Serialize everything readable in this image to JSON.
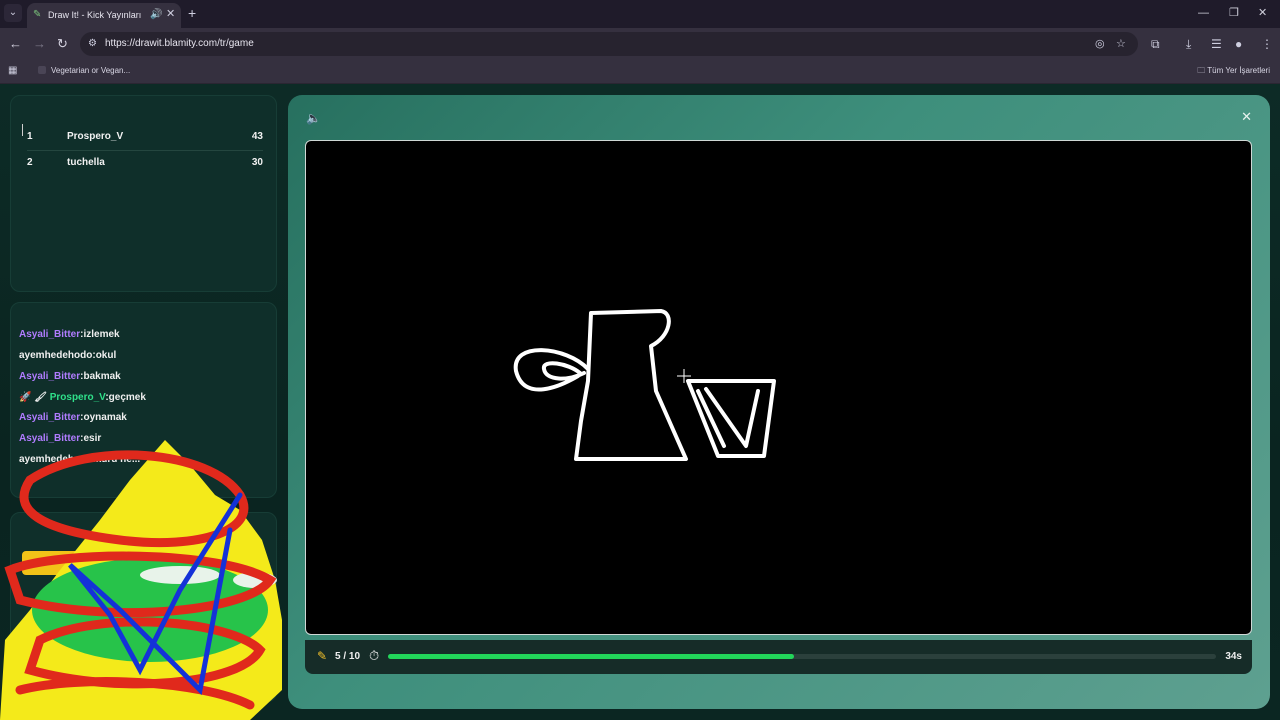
{
  "browser": {
    "tab_title": "Draw It! - Kick Yayınları İçin",
    "url": "https://drawit.blamity.com/tr/game",
    "bookmark": "Vegetarian or Vegan...",
    "all_bookmarks": "Tüm Yer İşaretleri"
  },
  "leaderboard": [
    {
      "rank": "1",
      "name": "Prospero_V",
      "score": "43"
    },
    {
      "rank": "2",
      "name": "tuchella",
      "score": "30"
    }
  ],
  "chat": [
    {
      "user": "Asyali_Bitter",
      "user_color": "#b07cff",
      "message": "izlemek"
    },
    {
      "user": "ayemhedehodo",
      "user_color": "#ffffff",
      "message": "okul"
    },
    {
      "user": "Asyali_Bitter",
      "user_color": "#b07cff",
      "message": "bakmak"
    },
    {
      "user": "Prospero_V",
      "user_color": "#2fe08a",
      "message": "geçmek",
      "badges": "🚀 🖌"
    },
    {
      "user": "Asyali_Bitter",
      "user_color": "#b07cff",
      "message": "oynamak"
    },
    {
      "user": "Asyali_Bitter",
      "user_color": "#b07cff",
      "message": "esir"
    },
    {
      "user": "ayemhedehodo",
      "user_color": "#ffffff",
      "message": "kuru ne..."
    }
  ],
  "game": {
    "round": "5 / 10",
    "time_left": "34s",
    "progress_fraction": 0.49,
    "accent": "#22d65a"
  },
  "guess_panel_label": "S"
}
